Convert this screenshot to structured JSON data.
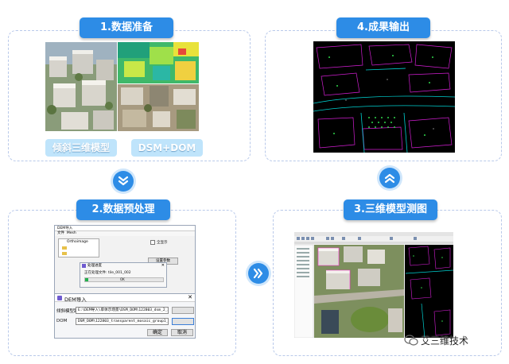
{
  "steps": {
    "s1": {
      "title": "1.数据准备",
      "labels": [
        "倾斜三维模型",
        "DSM+DOM"
      ]
    },
    "s2": {
      "title": "2.数据预处理"
    },
    "s3": {
      "title": "3.三维模型测图"
    },
    "s4": {
      "title": "4.成果输出"
    }
  },
  "dialog": {
    "title": "DEM导入",
    "row1_label": "倾斜模型路径",
    "row1_value": "E:\\DEM导入\\单体示场景\\DSM_DOM\\122803_dsm_2_2.tif",
    "row2_label": "DOM",
    "row2_value": "DSM_DOM\\122803_transparent_mosaic_group1_2_2.tif",
    "confirm": "确定",
    "cancel": "取消"
  },
  "bg_window": {
    "title": "DEM导入",
    "menu": [
      "文件",
      "Mesh"
    ],
    "tree_item": "Orthoimage",
    "check_label": "全显示",
    "button": "设置参数"
  },
  "progress": {
    "title": "处理进度",
    "text": "正在处理文件: tile_001_002",
    "ok": "OK",
    "fraction": 0.04
  },
  "watermark": "艾三维技术",
  "colors": {
    "accent": "#2d8ce6",
    "pill": "#bfe4fb",
    "border": "#b9c9ea"
  }
}
